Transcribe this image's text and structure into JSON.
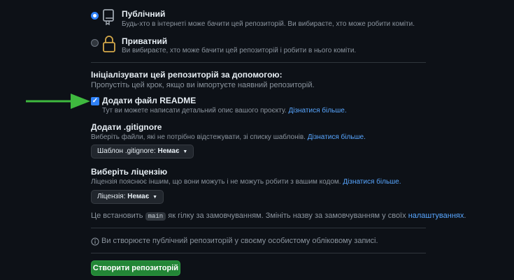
{
  "visibility": {
    "public": {
      "title": "Публічний",
      "description": "Будь-хто в інтернеті може бачити цей репозиторій. Ви вибираєте, хто може робити коміти.",
      "icon": "repo-icon",
      "checked": true
    },
    "private": {
      "title": "Приватний",
      "description": "Ви вибираєте, хто може бачити цей репозиторій і робити в нього коміти.",
      "icon": "lock-icon",
      "checked": false
    }
  },
  "init": {
    "heading": "Ініціалізувати цей репозиторій за допомогою:",
    "subtext": "Пропустіть цей крок, якщо ви імпортуєте наявний репозиторій."
  },
  "readme": {
    "label": "Додати файл README",
    "description": "Тут ви можете написати детальний опис вашого проєкту.",
    "link": "Дізнатися більше.",
    "checked": true
  },
  "gitignore": {
    "heading": "Додати .gitignore",
    "description": "Виберіть файли, які не потрібно відстежувати, зі списку шаблонів.",
    "link": "Дізнатися більше.",
    "select_prefix": "Шаблон .gitignore:",
    "select_value": "Немає"
  },
  "license": {
    "heading": "Виберіть ліцензію",
    "description": "Ліцензія пояснює іншим, що вони можуть і не можуть робити з вашим кодом.",
    "link": "Дізнатися більше.",
    "select_prefix": "Ліцензія:",
    "select_value": "Немає"
  },
  "branch": {
    "prefix": "Це встановить",
    "code": "main",
    "middle": "як гілку за замовчуванням. Змініть назву за замовчуванням у своїх",
    "link": "налаштуваннях",
    "suffix": "."
  },
  "notice": {
    "icon": "info-icon",
    "text": "Ви створюєте публічний репозиторій у своєму особистому обліковому записі."
  },
  "submit": {
    "label": "Створити репозиторій"
  },
  "colors": {
    "background": "#0d1117",
    "accent": "#2f81f7",
    "link": "#58a6ff",
    "button": "#238636",
    "arrow": "#3fb93f"
  }
}
